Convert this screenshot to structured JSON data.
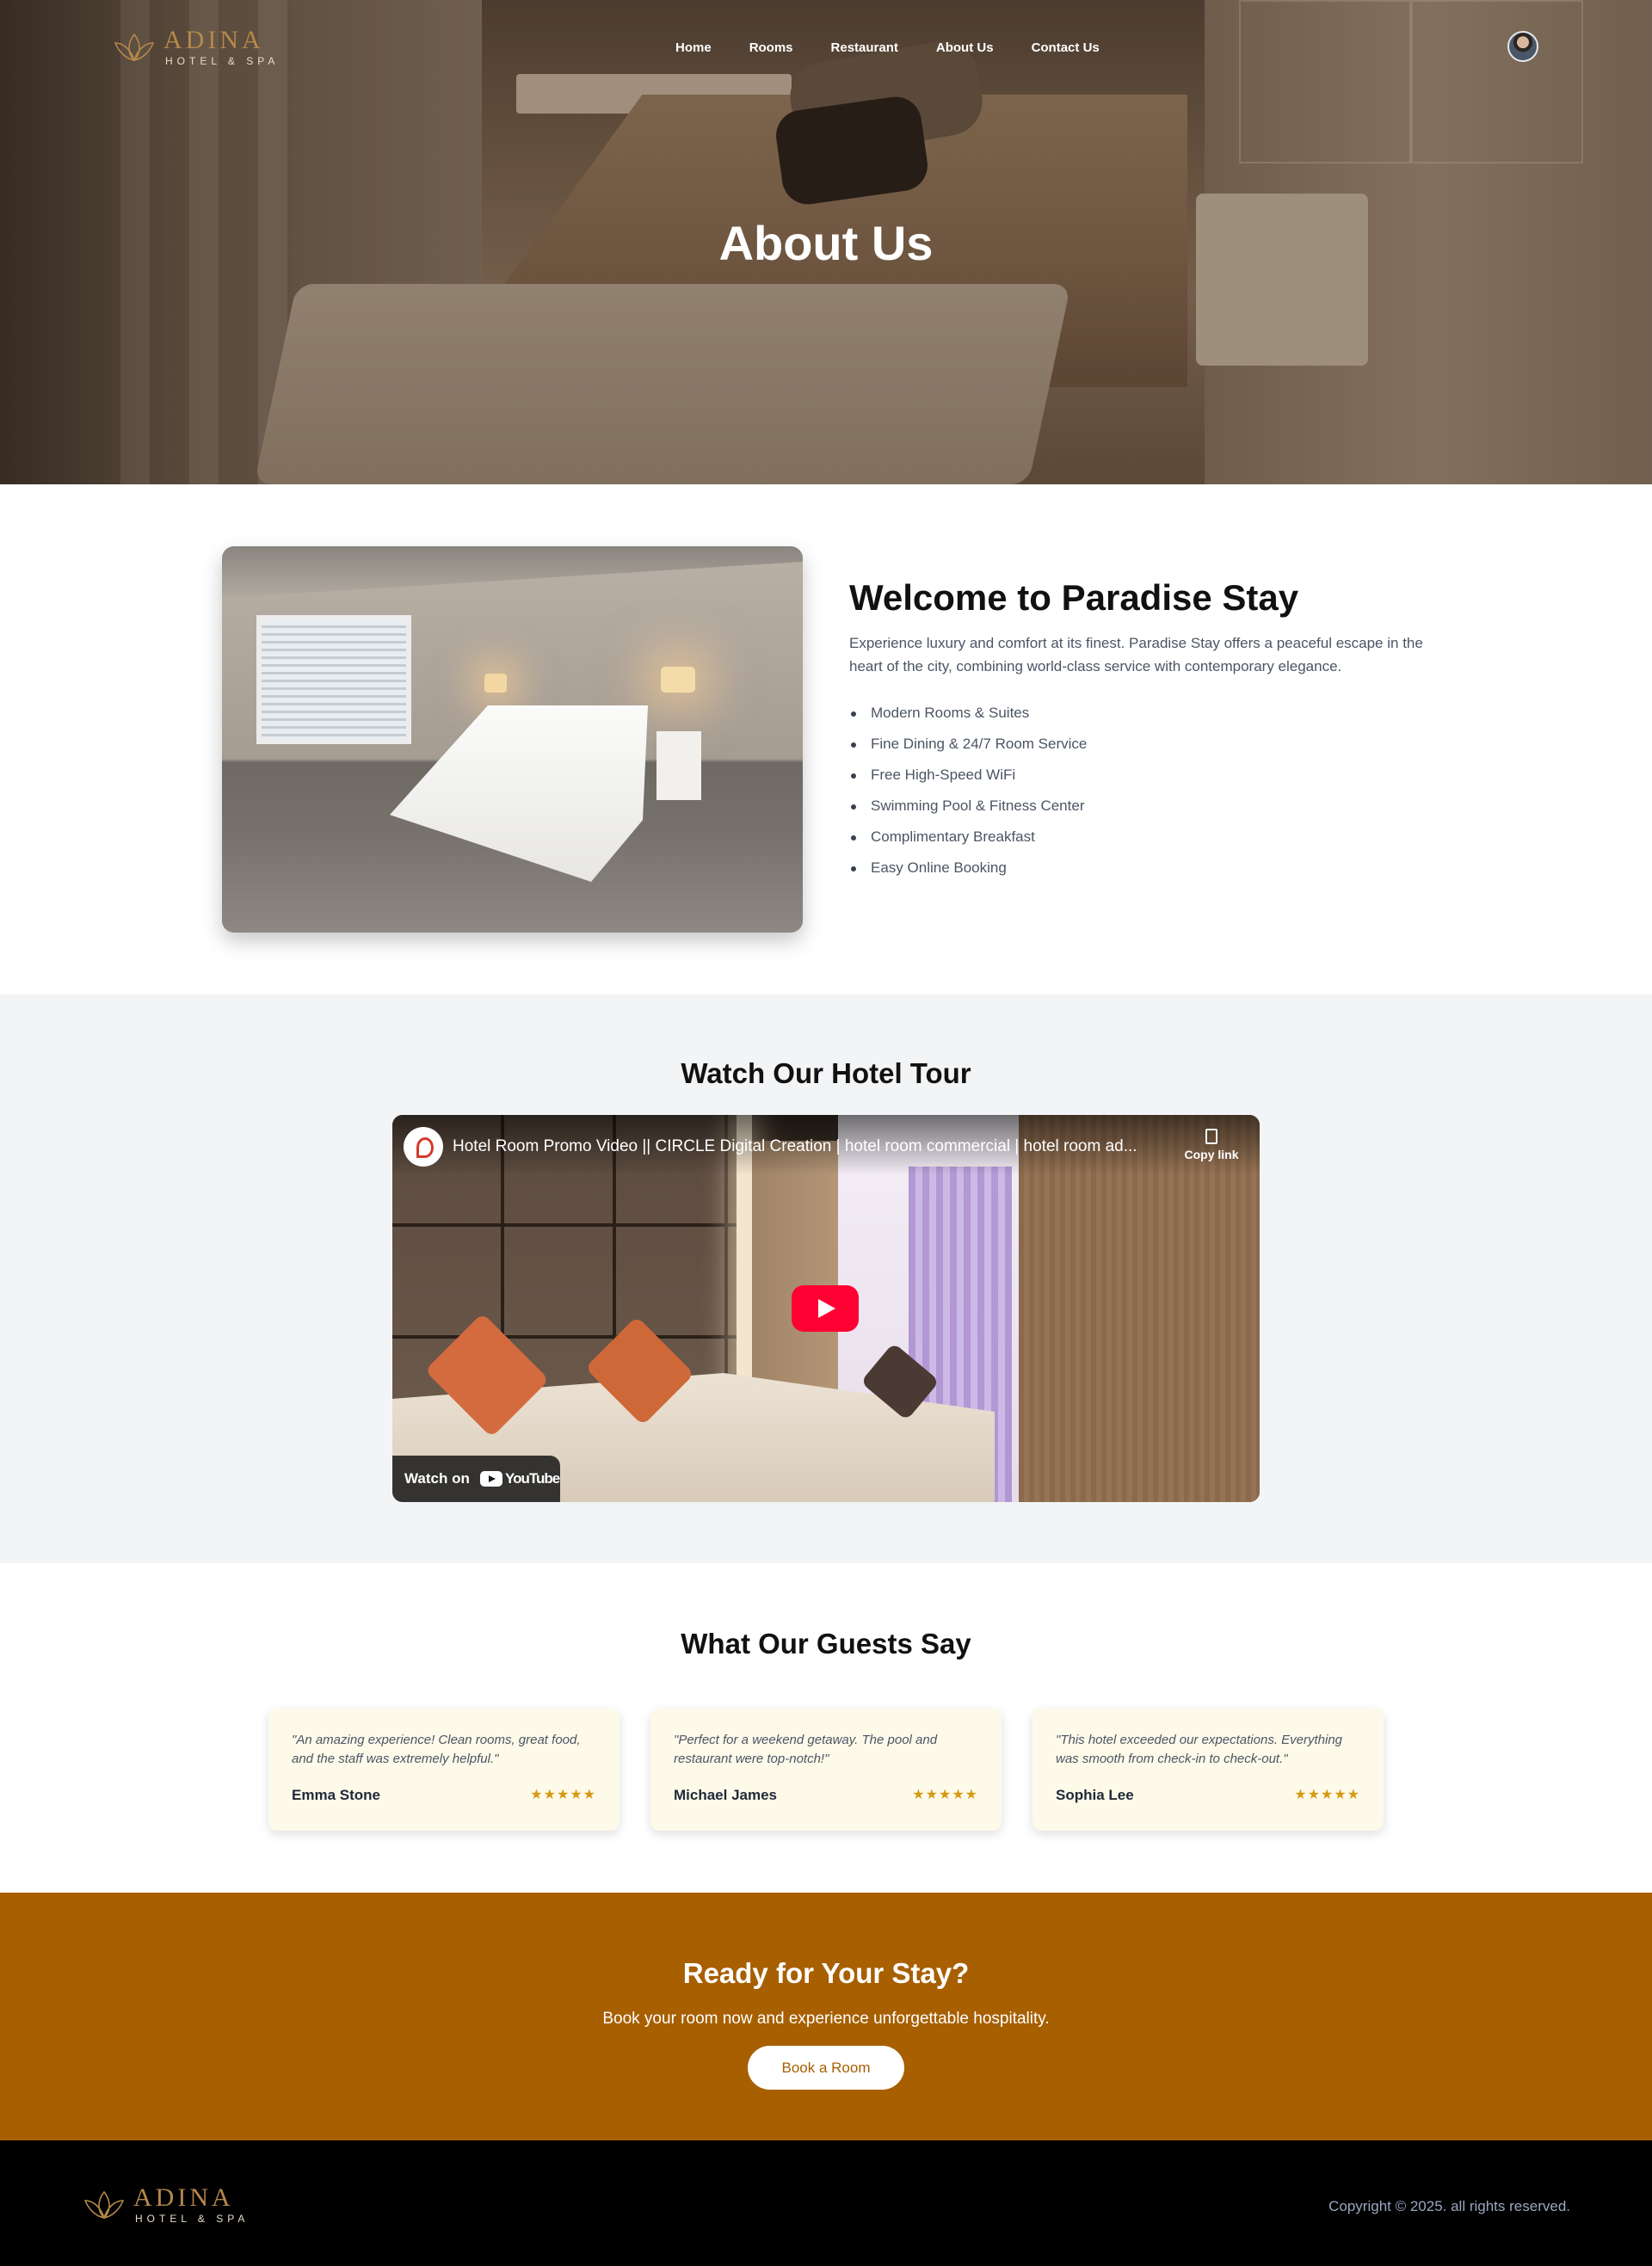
{
  "brand": {
    "name": "ADINA",
    "tagline": "HOTEL & SPA",
    "accent_color": "#b6884a",
    "logo_icon": "lotus-icon"
  },
  "nav": {
    "items": [
      {
        "label": "Home"
      },
      {
        "label": "Rooms"
      },
      {
        "label": "Restaurant"
      },
      {
        "label": "About Us"
      },
      {
        "label": "Contact Us"
      }
    ],
    "avatar_icon": "user-avatar"
  },
  "hero": {
    "title": "About Us"
  },
  "welcome": {
    "title": "Welcome to Paradise Stay",
    "description": "Experience luxury and comfort at its finest. Paradise Stay offers a peaceful escape in the heart of the city, combining world-class service with contemporary elegance.",
    "features": [
      "Modern Rooms & Suites",
      "Fine Dining & 24/7 Room Service",
      "Free High-Speed WiFi",
      "Swimming Pool & Fitness Center",
      "Complimentary Breakfast",
      "Easy Online Booking"
    ]
  },
  "tour": {
    "title": "Watch Our Hotel Tour",
    "video_title": "Hotel Room Promo Video || CIRCLE Digital Creation | hotel room commercial | hotel room ad...",
    "copy_link_label": "Copy link",
    "watch_on_label": "Watch on",
    "youtube_label": "YouTube",
    "play_color": "#ff0033"
  },
  "testimonials": {
    "title": "What Our Guests Say",
    "items": [
      {
        "quote": "\"An amazing experience! Clean rooms, great food, and the staff was extremely helpful.\"",
        "name": "Emma Stone",
        "stars": "★★★★★",
        "rating": 5
      },
      {
        "quote": "\"Perfect for a weekend getaway. The pool and restaurant were top-notch!\"",
        "name": "Michael James",
        "stars": "★★★★★",
        "rating": 5
      },
      {
        "quote": "\"This hotel exceeded our expectations. Everything was smooth from check-in to check-out.\"",
        "name": "Sophia Lee",
        "stars": "★★★★★",
        "rating": 5
      }
    ],
    "card_color": "#fefaea",
    "star_color": "#d69a12"
  },
  "cta": {
    "title": "Ready for Your Stay?",
    "subtitle": "Book your room now and experience unforgettable hospitality.",
    "button_label": "Book a Room",
    "background_color": "#a75f00"
  },
  "footer": {
    "copyright": "Copyright © 2025. all rights reserved."
  }
}
